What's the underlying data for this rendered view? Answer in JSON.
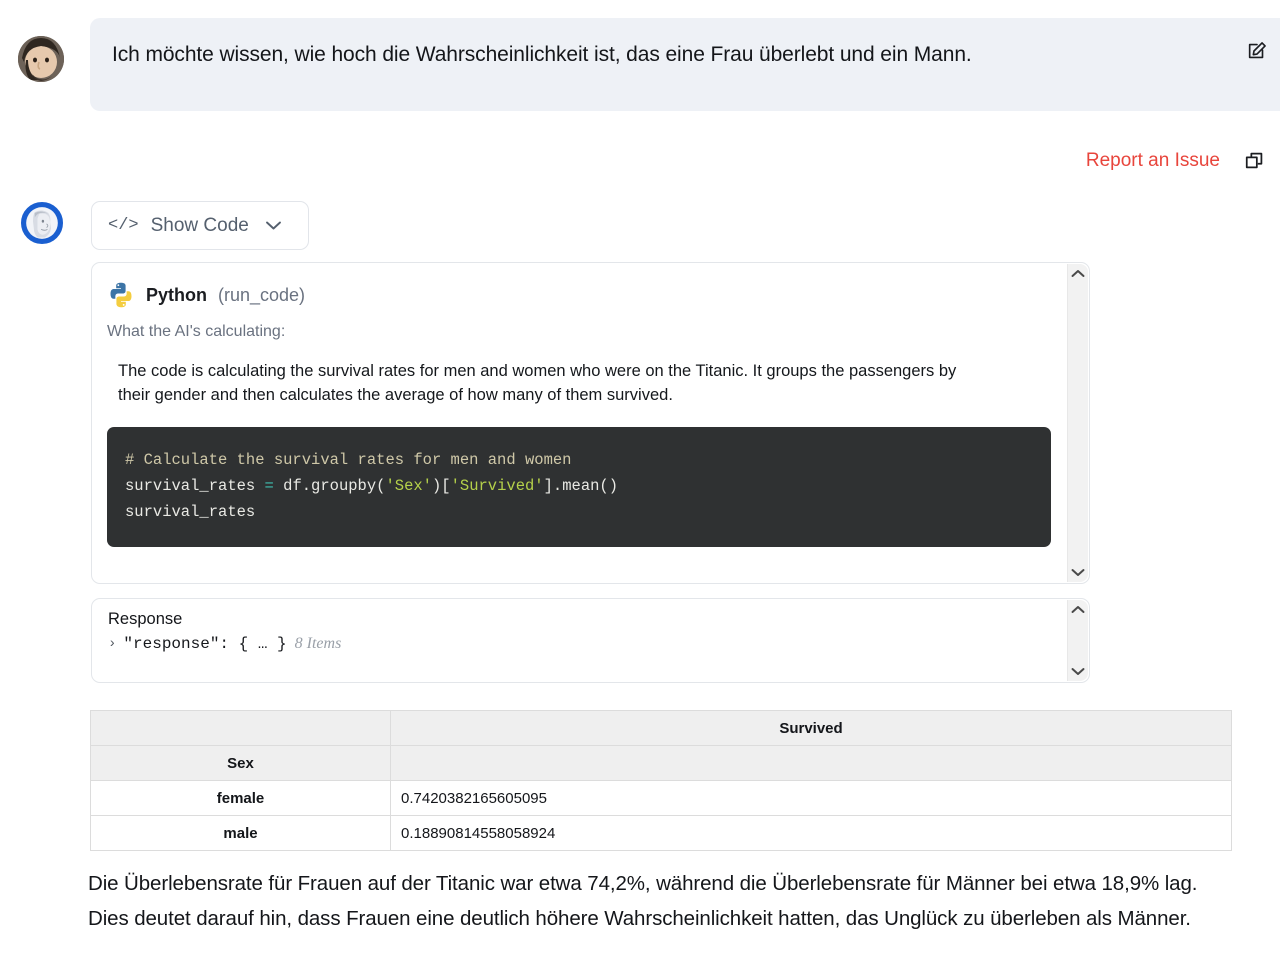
{
  "user_message": {
    "text": "Ich möchte wissen, wie hoch die Wahrscheinlichkeit ist, das eine Frau überlebt und ein Mann.",
    "edit_icon": "edit-pencil-square-icon",
    "avatar": "user-avatar-photo"
  },
  "actions": {
    "report_label": "Report an Issue",
    "report_color": "#e8453c",
    "copy_icon": "copy-duplicate-icon"
  },
  "assistant": {
    "avatar": "ai-classical-bust-icon",
    "show_code": {
      "glyph": "</>",
      "label": "Show Code",
      "chevron": "chevron-down-icon"
    }
  },
  "code_panel": {
    "tool_name": "Python",
    "tool_call": "(run_code)",
    "logo": "python-logo-icon",
    "what_label": "What the AI's calculating:",
    "explanation": "The code is calculating the survival rates for men and women who were on the Titanic. It groups the passengers by their gender and then calculates the average of how many of them survived.",
    "code": {
      "line1_comment": "# Calculate the survival rates for men and women",
      "line2_a": "survival_rates ",
      "line2_op": "=",
      "line2_b": " df.groupby(",
      "line2_str1": "'Sex'",
      "line2_c": ")[",
      "line2_str2": "'Survived'",
      "line2_d": "].mean()",
      "line3": "survival_rates"
    },
    "scroll_up_icon": "chevron-up-icon",
    "scroll_down_icon": "chevron-down-icon"
  },
  "response_panel": {
    "title": "Response",
    "caret": "›",
    "key": "\"response\": { … }",
    "items": "8 Items",
    "scroll_up_icon": "chevron-up-icon",
    "scroll_down_icon": "chevron-down-icon"
  },
  "table": {
    "col_header_blank": "",
    "col_header_value": "Survived",
    "index_name": "Sex",
    "rows": [
      {
        "label": "female",
        "value": "0.7420382165605095"
      },
      {
        "label": "male",
        "value": "0.18890814558058924"
      }
    ]
  },
  "answer": {
    "text": "Die Überlebensrate für Frauen auf der Titanic war etwa 74,2%, während die Überlebensrate für Männer bei etwa 18,9% lag. Dies deutet darauf hin, dass Frauen eine deutlich höhere Wahrscheinlichkeit hatten, das Unglück zu überleben als Männer."
  }
}
